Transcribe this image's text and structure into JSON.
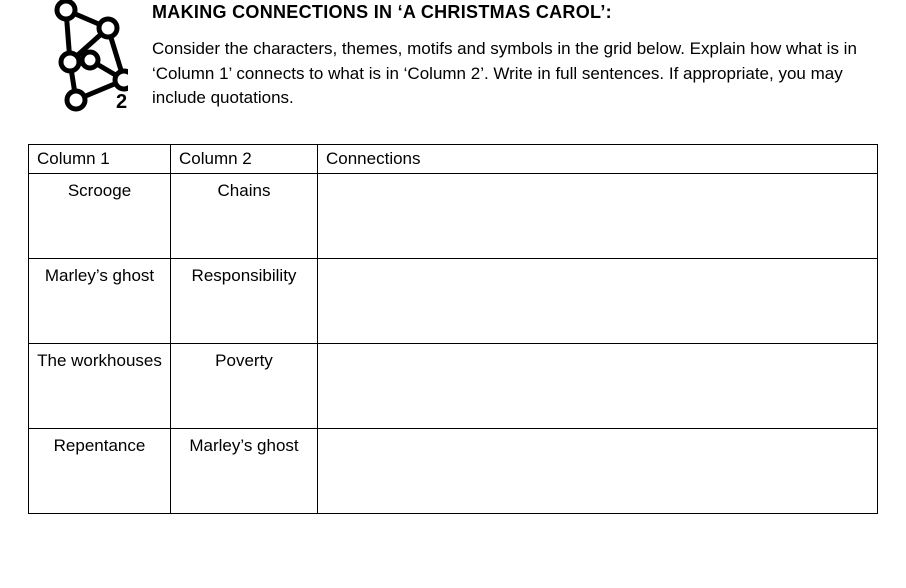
{
  "header": {
    "title": "MAKING CONNECTIONS IN ‘A CHRISTMAS CAROL’:",
    "instructions": "Consider the characters, themes, motifs and symbols in the grid below. Explain how what is in ‘Column 1’ connects to what is in ‘Column 2’. Write in full sentences. If appropriate, you may include quotations.",
    "icon_number": "2"
  },
  "table": {
    "headers": {
      "col1": "Column 1",
      "col2": "Column 2",
      "col3": "Connections"
    },
    "rows": [
      {
        "col1": "Scrooge",
        "col2": "Chains",
        "col3": ""
      },
      {
        "col1": "Marley’s ghost",
        "col2": "Responsibility",
        "col3": ""
      },
      {
        "col1": "The workhouses",
        "col2": "Poverty",
        "col3": ""
      },
      {
        "col1": "Repentance",
        "col2": "Marley’s ghost",
        "col3": ""
      }
    ]
  }
}
